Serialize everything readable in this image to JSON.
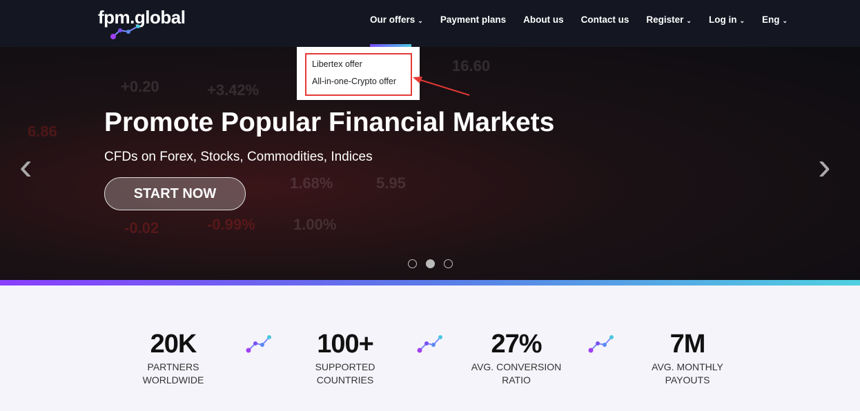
{
  "header": {
    "logo": "fpm.global",
    "nav": [
      {
        "label": "Our offers",
        "dropdown": true
      },
      {
        "label": "Payment plans",
        "dropdown": false
      },
      {
        "label": "About us",
        "dropdown": false
      },
      {
        "label": "Contact us",
        "dropdown": false
      },
      {
        "label": "Register",
        "dropdown": true
      },
      {
        "label": "Log in",
        "dropdown": true
      },
      {
        "label": "Eng",
        "dropdown": true
      }
    ]
  },
  "dropdown": {
    "items": [
      "Libertex offer",
      "All-in-one-Crypto offer"
    ]
  },
  "hero": {
    "title": "Promote Popular Financial Markets",
    "subtitle": "CFDs on Forex, Stocks, Commodities, Indices",
    "cta": "START NOW",
    "slides": 3,
    "active_slide": 2
  },
  "stats": [
    {
      "value": "20K",
      "label1": "PARTNERS",
      "label2": "WORLDWIDE"
    },
    {
      "value": "100+",
      "label1": "SUPPORTED",
      "label2": "COUNTRIES"
    },
    {
      "value": "27%",
      "label1": "AVG. CONVERSION",
      "label2": "RATIO"
    },
    {
      "value": "7M",
      "label1": "AVG. MONTHLY",
      "label2": "PAYOUTS"
    }
  ],
  "colors": {
    "header": "#141722",
    "accent_purple": "#8a3ffc",
    "accent_cyan": "#4fd0e0",
    "annotation": "#e53935"
  }
}
